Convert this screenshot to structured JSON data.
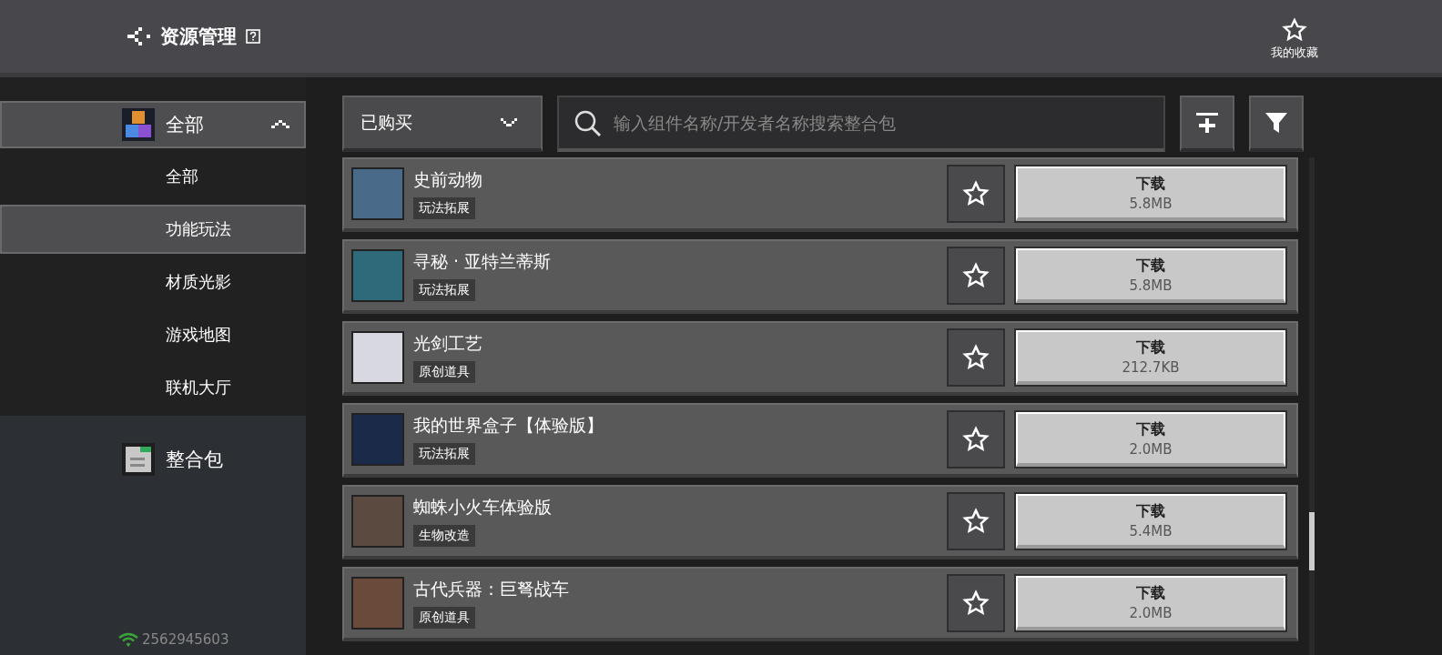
{
  "header": {
    "title": "资源管理",
    "favorites_label": "我的收藏"
  },
  "sidebar": {
    "groups": [
      {
        "label": "全部",
        "kind": "all",
        "expanded": true,
        "items": [
          {
            "label": "全部",
            "selected": false
          },
          {
            "label": "功能玩法",
            "selected": true
          },
          {
            "label": "材质光影",
            "selected": false
          },
          {
            "label": "游戏地图",
            "selected": false
          },
          {
            "label": "联机大厅",
            "selected": false
          }
        ]
      },
      {
        "label": "整合包",
        "kind": "pack",
        "expanded": false
      }
    ],
    "account_id": "2562945603"
  },
  "toolbar": {
    "filter_value": "已购买",
    "search": {
      "placeholder": "输入组件名称/开发者名称搜索整合包"
    }
  },
  "items": [
    {
      "title": "史前动物",
      "tag": "玩法拓展",
      "action": "下载",
      "size": "5.8MB",
      "color": "#4a6a8a"
    },
    {
      "title": "寻秘 · 亚特兰蒂斯",
      "tag": "玩法拓展",
      "action": "下载",
      "size": "5.8MB",
      "color": "#2f6a7a"
    },
    {
      "title": "光剑工艺",
      "tag": "原创道具",
      "action": "下载",
      "size": "212.7KB",
      "color": "#d8d8e0"
    },
    {
      "title": "我的世界盒子【体验版】",
      "tag": "玩法拓展",
      "action": "下载",
      "size": "2.0MB",
      "color": "#1c2a4a"
    },
    {
      "title": "蜘蛛小火车体验版",
      "tag": "生物改造",
      "action": "下载",
      "size": "5.4MB",
      "color": "#5a4a40"
    },
    {
      "title": "古代兵器：巨弩战车",
      "tag": "原创道具",
      "action": "下载",
      "size": "2.0MB",
      "color": "#6a4a3a"
    }
  ]
}
